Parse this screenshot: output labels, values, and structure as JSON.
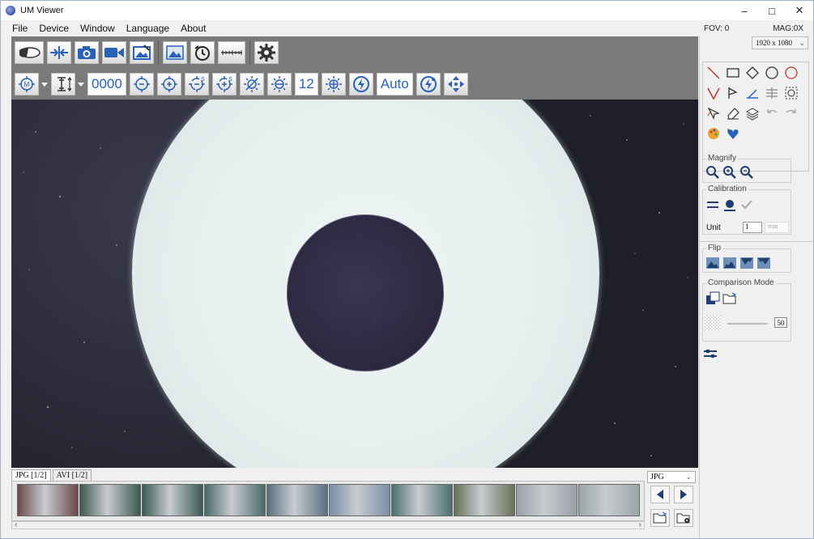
{
  "window": {
    "title": "UM Viewer",
    "minimize": "–",
    "maximize": "□",
    "close": "✕"
  },
  "menu": {
    "items": [
      "File",
      "Device",
      "Window",
      "Language",
      "About"
    ]
  },
  "status": {
    "fov": "FOV: 0",
    "mag": "MAG:0X"
  },
  "toolbar2": {
    "counter": "0000",
    "value_12": "12",
    "auto_label": "Auto"
  },
  "icons": {
    "row1": [
      "led-light-icon",
      "compress-icon",
      "camera-icon",
      "video-camera-icon",
      "photo-edit-icon",
      "image-icon",
      "timer-icon",
      "ruler-icon",
      "settings-gear-icon"
    ],
    "row2": [
      "measurement-mode-icon",
      "height-adjust-icon",
      "target-minus-icon",
      "target-plus-icon",
      "focus-minus-icon",
      "focus-plus-icon",
      "brightness-minus-icon",
      "brightness-icon",
      "brightness-plus-icon",
      "flash-icon",
      "flash-alt-icon",
      "move-arrows-icon"
    ]
  },
  "files": {
    "tab_jpg": "JPG [1/2]",
    "tab_avi": "AVI [1/2]",
    "format": "JPG"
  },
  "filmstrip": {
    "colors": [
      "#6b4a4a",
      "#3d5a4f",
      "#3a5a52",
      "#4a6a6a",
      "#5a7080",
      "#7a8fa6",
      "#4c6e70",
      "#6a705a",
      "#9aa0a8",
      "#9aa6a8"
    ]
  },
  "right_panel": {
    "resolution": "1920 x 1080",
    "magnify_label": "Magnify",
    "calibration_label": "Calibration",
    "unit_label": "Unit",
    "unit_value": "1",
    "unit_select": "mm",
    "flip_label": "Flip",
    "comparison_label": "Comparison Mode",
    "opacity_value": "50"
  },
  "colors": {
    "toolbar_bg": "#7a7a7a",
    "accent_blue": "#2a62b8",
    "ring": "#e6efee",
    "core": "#2c2840"
  }
}
